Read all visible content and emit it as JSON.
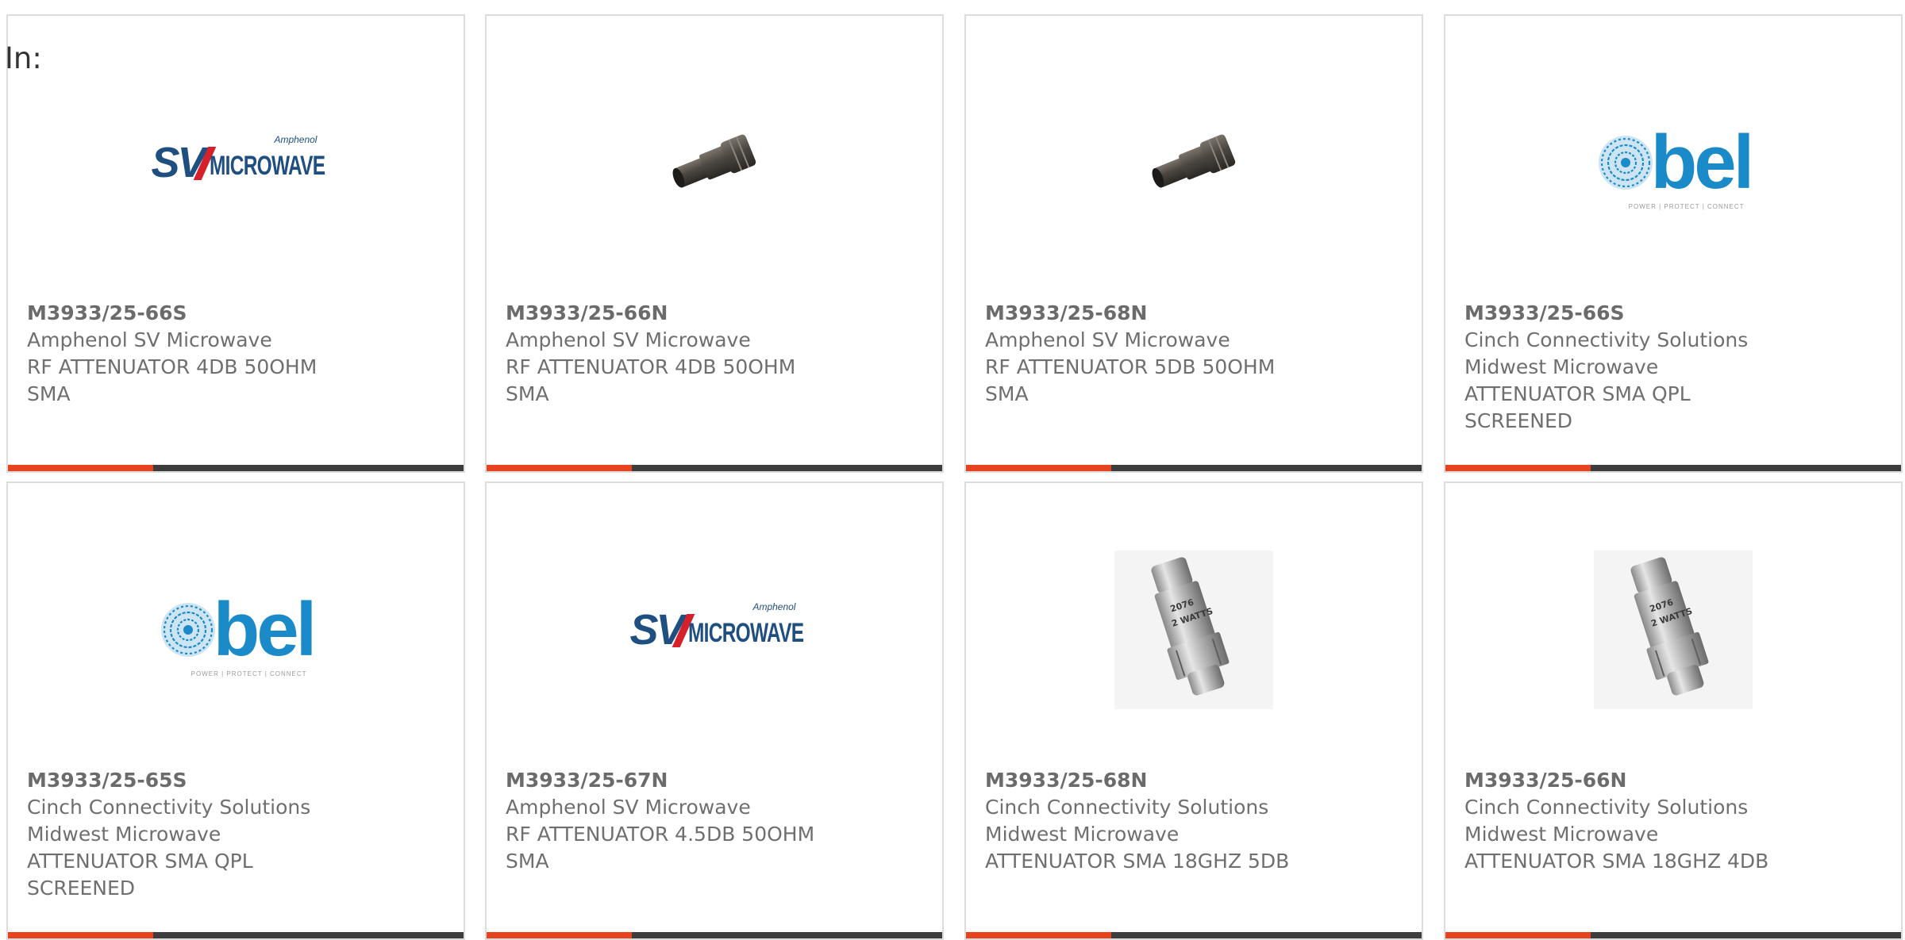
{
  "section_label": "In:",
  "colors": {
    "accent": "#e8431f",
    "bar_dark": "#3d3d3d",
    "card_border": "#dcdcdc",
    "text": "#6f6f6f",
    "sv_blue": "#1f4e80",
    "sv_red": "#d6202b",
    "bel_blue": "#1b8ac8"
  },
  "logos": {
    "sv": {
      "main": "SV",
      "sub": "MICROWAVE",
      "brand": "Amphenol"
    },
    "bel": {
      "word": "bel",
      "tagline": "POWER | PROTECT | CONNECT"
    }
  },
  "products": [
    {
      "part_number": "M3933/25-66S",
      "manufacturer": "Amphenol SV Microwave",
      "description": [
        "RF ATTENUATOR 4DB 50OHM",
        "SMA"
      ],
      "image": "sv-microwave-logo"
    },
    {
      "part_number": "M3933/25-66N",
      "manufacturer": "Amphenol SV Microwave",
      "description": [
        "RF ATTENUATOR 4DB 50OHM",
        "SMA"
      ],
      "image": "attenuator-dark-photo"
    },
    {
      "part_number": "M3933/25-68N",
      "manufacturer": "Amphenol SV Microwave",
      "description": [
        "RF ATTENUATOR 5DB 50OHM",
        "SMA"
      ],
      "image": "attenuator-dark-photo"
    },
    {
      "part_number": "M3933/25-66S",
      "manufacturer": "Cinch Connectivity Solutions",
      "sub_manufacturer": "Midwest Microwave",
      "description": [
        "ATTENUATOR SMA QPL",
        "SCREENED"
      ],
      "image": "bel-logo"
    },
    {
      "part_number": "M3933/25-65S",
      "manufacturer": "Cinch Connectivity Solutions",
      "sub_manufacturer": "Midwest Microwave",
      "description": [
        "ATTENUATOR SMA QPL",
        "SCREENED"
      ],
      "image": "bel-logo"
    },
    {
      "part_number": "M3933/25-67N",
      "manufacturer": "Amphenol SV Microwave",
      "description": [
        "RF ATTENUATOR 4.5DB 50OHM",
        "SMA"
      ],
      "image": "sv-microwave-logo"
    },
    {
      "part_number": "M3933/25-68N",
      "manufacturer": "Cinch Connectivity Solutions",
      "sub_manufacturer": "Midwest Microwave",
      "description": [
        "ATTENUATOR SMA 18GHZ 5DB"
      ],
      "image": "attenuator-steel-photo"
    },
    {
      "part_number": "M3933/25-66N",
      "manufacturer": "Cinch Connectivity Solutions",
      "sub_manufacturer": "Midwest Microwave",
      "description": [
        "ATTENUATOR SMA 18GHZ 4DB"
      ],
      "image": "attenuator-steel-photo"
    }
  ]
}
